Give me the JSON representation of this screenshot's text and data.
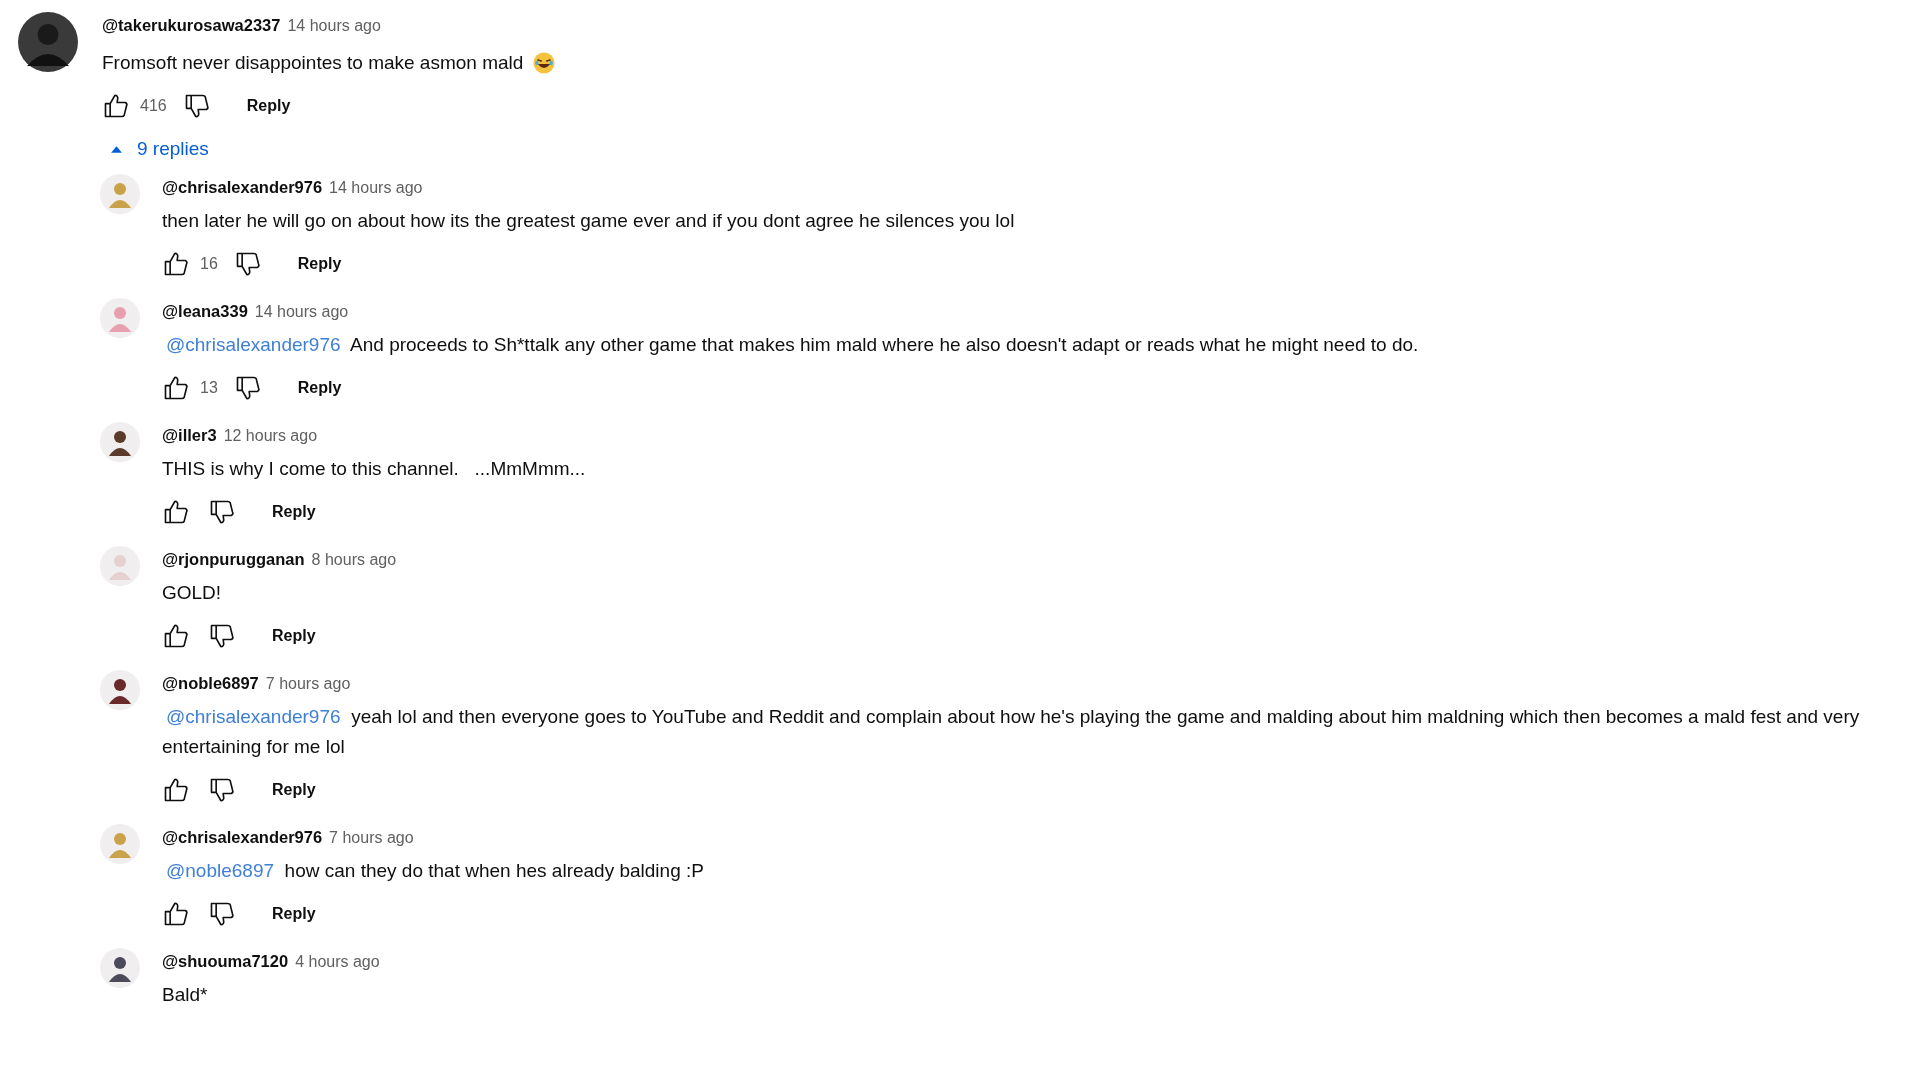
{
  "comment": {
    "author": "@takerukurosawa2337",
    "time": "14 hours ago",
    "text": "Fromsoft never disappointes to make asmon mald",
    "likes": "416",
    "reply_label": "Reply"
  },
  "replies_toggle": {
    "label": "9 replies",
    "expanded": true
  },
  "replies": [
    {
      "author": "@chrisalexander976",
      "time": "14 hours ago",
      "text": "then later he will go on about how its the greatest game ever and if you dont agree he silences you lol",
      "likes": "16",
      "reply_label": "Reply"
    },
    {
      "author": "@leana339",
      "time": "14 hours ago",
      "mention": "@chrisalexander976",
      "text": "And proceeds to Sh*ttalk any other game that makes him mald where he also doesn't adapt or reads what he might need to do.",
      "likes": "13",
      "reply_label": "Reply"
    },
    {
      "author": "@iller3",
      "time": "12 hours ago",
      "text": "THIS is why I come to this channel.   ...MmMmm...",
      "reply_label": "Reply"
    },
    {
      "author": "@rjonpurugganan",
      "time": "8 hours ago",
      "text": "GOLD!",
      "reply_label": "Reply"
    },
    {
      "author": "@noble6897",
      "time": "7 hours ago",
      "mention": "@chrisalexander976",
      "text": "yeah lol and then everyone goes to YouTube and Reddit and complain about how he's playing the game and malding about him maldning which then becomes a mald fest and very entertaining for me lol",
      "reply_label": "Reply"
    },
    {
      "author": "@chrisalexander976",
      "time": "7 hours ago",
      "mention": "@noble6897",
      "text": "how can they do that when hes already balding :P",
      "reply_label": "Reply"
    },
    {
      "author": "@shuouma7120",
      "time": "4 hours ago",
      "text": "Bald*"
    }
  ]
}
